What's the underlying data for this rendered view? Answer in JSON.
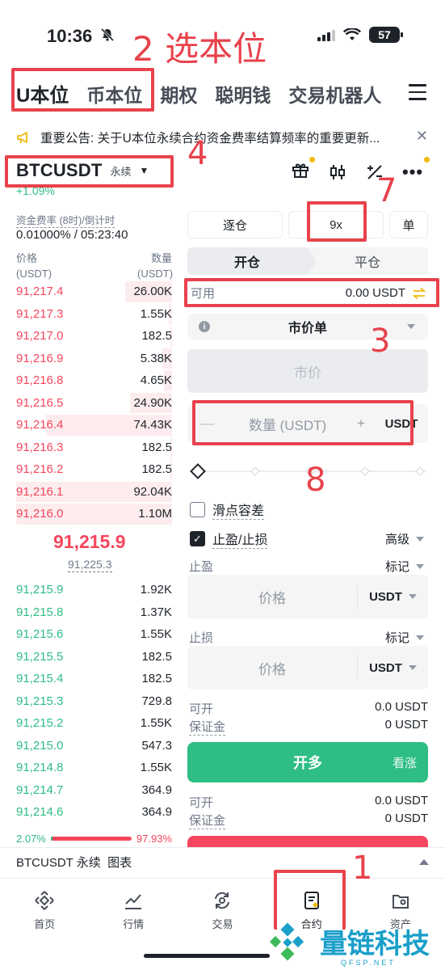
{
  "status_bar": {
    "time": "10:36",
    "battery": "57"
  },
  "tabs": [
    "U本位",
    "币本位",
    "期权",
    "聪明钱",
    "交易机器人"
  ],
  "announcement": {
    "text": "重要公告: 关于U本位永续合约资金费率结算频率的重要更新..."
  },
  "symbol": {
    "name": "BTCUSDT",
    "tag": "永续",
    "change": "+1.09%"
  },
  "funding": {
    "label": "资金费率 (8时)/倒计时",
    "value": "0.01000% / 05:23:40"
  },
  "orderbook": {
    "price_header": [
      "价格",
      "(USDT)"
    ],
    "qty_header": [
      "数量",
      "(USDT)"
    ],
    "asks": [
      {
        "price": "91,217.4",
        "qty": "26.00K",
        "depth": 0.3
      },
      {
        "price": "91,217.3",
        "qty": "1.55K",
        "depth": 0.02
      },
      {
        "price": "91,217.0",
        "qty": "182.5",
        "depth": 0.01
      },
      {
        "price": "91,216.9",
        "qty": "5.38K",
        "depth": 0.06
      },
      {
        "price": "91,216.8",
        "qty": "4.65K",
        "depth": 0.05
      },
      {
        "price": "91,216.5",
        "qty": "24.90K",
        "depth": 0.27
      },
      {
        "price": "91,216.4",
        "qty": "74.43K",
        "depth": 0.81
      },
      {
        "price": "91,216.3",
        "qty": "182.5",
        "depth": 0.01
      },
      {
        "price": "91,216.2",
        "qty": "182.5",
        "depth": 0.01
      },
      {
        "price": "91,216.1",
        "qty": "92.04K",
        "depth": 1.0
      },
      {
        "price": "91,216.0",
        "qty": "1.10M",
        "depth": 1.0
      }
    ],
    "last_price": "91,215.9",
    "mark_price": "91,225.3",
    "bids": [
      {
        "price": "91,215.9",
        "qty": "1.92K"
      },
      {
        "price": "91,215.8",
        "qty": "1.37K"
      },
      {
        "price": "91,215.6",
        "qty": "1.55K"
      },
      {
        "price": "91,215.5",
        "qty": "182.5"
      },
      {
        "price": "91,215.4",
        "qty": "182.5"
      },
      {
        "price": "91,215.3",
        "qty": "729.8"
      },
      {
        "price": "91,215.2",
        "qty": "1.55K"
      },
      {
        "price": "91,215.0",
        "qty": "547.3"
      },
      {
        "price": "91,214.8",
        "qty": "1.55K"
      },
      {
        "price": "91,214.7",
        "qty": "364.9"
      },
      {
        "price": "91,214.6",
        "qty": "364.9"
      }
    ],
    "buy_ratio": "2.07%",
    "sell_ratio": "97.93%",
    "buy_ratio_value": 0.0207
  },
  "order_form": {
    "margin_mode": "逐仓",
    "leverage": "9x",
    "position_mode": "单",
    "open_tab": "开仓",
    "close_tab": "平仓",
    "available_label": "可用",
    "available_value": "0.00 USDT",
    "order_type": "市价单",
    "price_placeholder": "市价",
    "qty_placeholder": "数量 (USDT)",
    "qty_unit": "USDT",
    "slippage_label": "滑点容差",
    "tpsl_label": "止盈/止损",
    "advanced_label": "高级",
    "tp_label": "止盈",
    "sl_label": "止损",
    "trigger_label": "标记",
    "price_ph": "价格",
    "unit": "USDT",
    "buy": {
      "max_label": "可开",
      "max_value": "0.0 USDT",
      "margin_label": "保证金",
      "margin_value": "0 USDT",
      "btn": "开多",
      "side": "看涨"
    },
    "sell": {
      "max_label": "可开",
      "max_value": "0.0 USDT",
      "margin_label": "保证金",
      "margin_value": "0 USDT"
    }
  },
  "chart_bar": {
    "label": "BTCUSDT 永续  图表"
  },
  "tabbar": [
    "首页",
    "行情",
    "交易",
    "合约",
    "资产"
  ],
  "annotations": {
    "n1": "1",
    "n2": "2 选本位",
    "n3": "3",
    "n4": "4",
    "n7": "7",
    "n8": "8"
  },
  "watermark": {
    "text": "量链科技",
    "sub": "QFSP.NET"
  },
  "colors": {
    "green": "#2ebd85",
    "red": "#f6465d",
    "annotation": "#e8424c"
  }
}
